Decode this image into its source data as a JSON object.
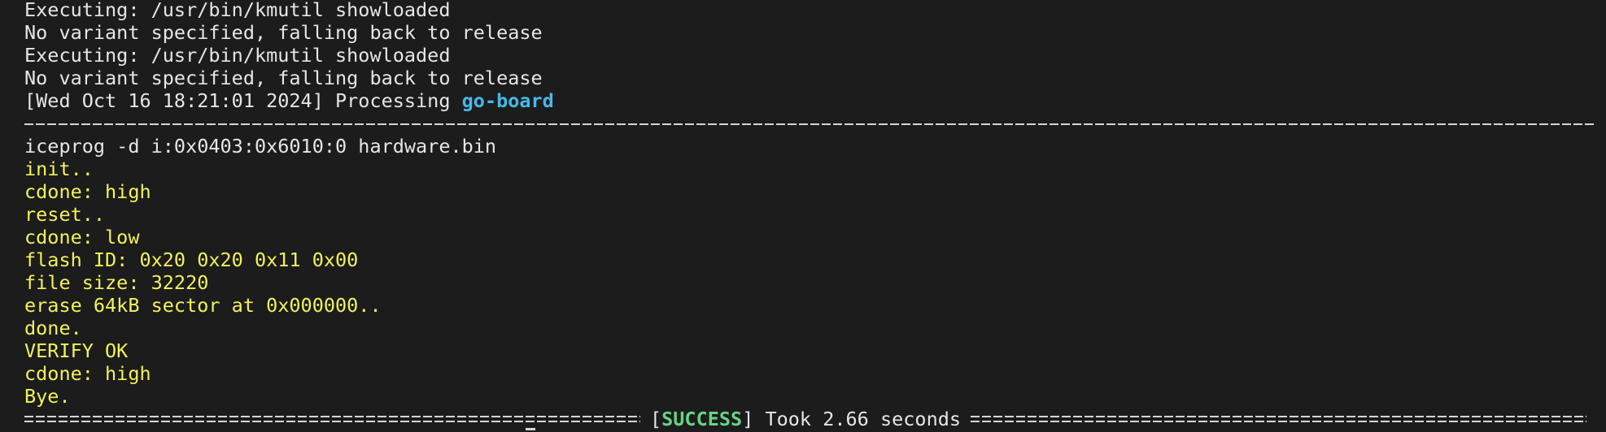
{
  "terminal": {
    "lines": [
      {
        "text": "Executing: /usr/bin/kmutil showloaded"
      },
      {
        "text": "No variant specified, falling back to release"
      },
      {
        "text": "Executing: /usr/bin/kmutil showloaded"
      },
      {
        "text": "No variant specified, falling back to release"
      }
    ],
    "processing": {
      "prefix": "[Wed Oct 16 18:21:01 2024] Processing ",
      "board": "go-board"
    },
    "command": "iceprog -d i:0x0403:0x6010:0 hardware.bin",
    "output": [
      "init..",
      "cdone: high",
      "reset..",
      "cdone: low",
      "flash ID: 0x20 0x20 0x11 0x00",
      "file size: 32220",
      "erase 64kB sector at 0x000000..",
      "done.",
      "VERIFY OK",
      "cdone: high",
      "Bye."
    ],
    "summary": {
      "open_bracket": "[",
      "status": "SUCCESS",
      "close_bracket": "]",
      "took": " Took 2.66 seconds"
    }
  },
  "colors": {
    "background": "#1c1c1c",
    "default_text": "#e6e6e6",
    "output_text": "#f2f25a",
    "board_name": "#44b9e9",
    "success": "#67d387"
  }
}
